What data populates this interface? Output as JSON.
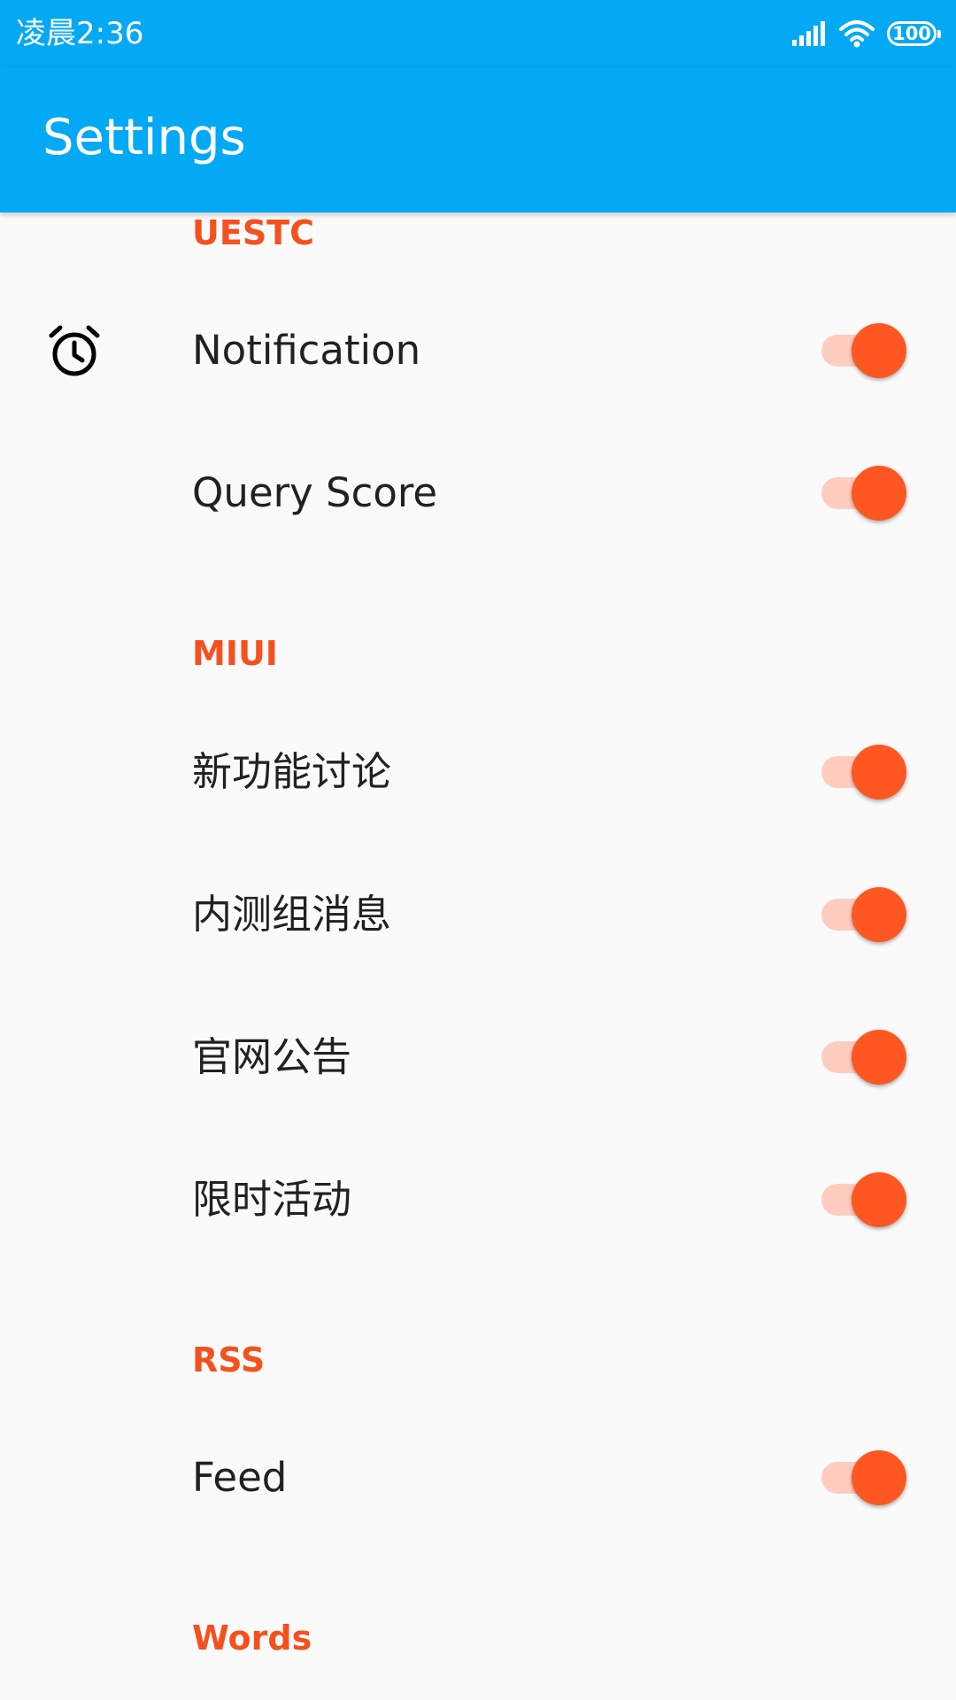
{
  "status_bar": {
    "time": "凌晨2:36",
    "battery": "100",
    "icons": [
      "signal-icon",
      "wifi-icon",
      "battery-icon"
    ]
  },
  "app_bar": {
    "title": "Settings"
  },
  "colors": {
    "app_bar": "#03a9f4",
    "accent": "#ff5722",
    "section_header": "#f4511e",
    "switch_track_on": "#ffcdc0",
    "text_primary": "#212121",
    "background": "#fafafa"
  },
  "sections": [
    {
      "header": "UESTC",
      "items": [
        {
          "label": "Notification",
          "icon": "alarm-clock-icon",
          "enabled": true
        },
        {
          "label": "Query Score",
          "enabled": true
        }
      ]
    },
    {
      "header": "MIUI",
      "items": [
        {
          "label": "新功能讨论",
          "enabled": true
        },
        {
          "label": "内测组消息",
          "enabled": true
        },
        {
          "label": "官网公告",
          "enabled": true
        },
        {
          "label": "限时活动",
          "enabled": true
        }
      ]
    },
    {
      "header": "RSS",
      "items": [
        {
          "label": "Feed",
          "enabled": true
        }
      ]
    },
    {
      "header": "Words",
      "items": []
    }
  ]
}
